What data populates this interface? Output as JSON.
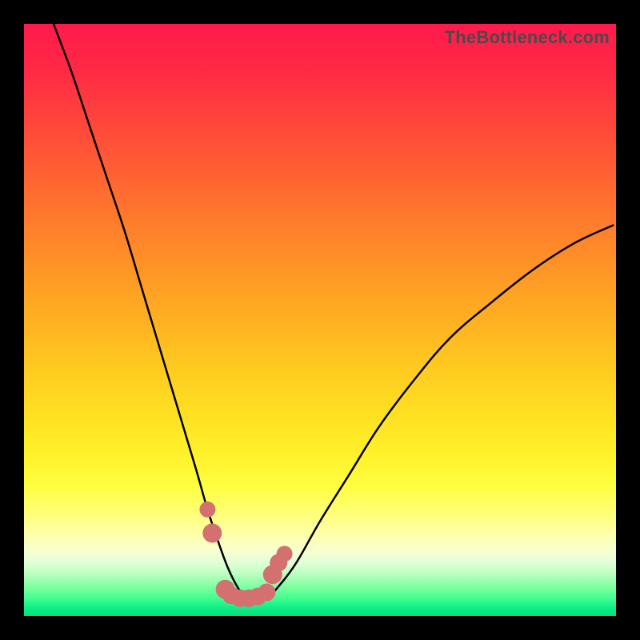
{
  "watermark": "TheBottleneck.com",
  "chart_data": {
    "type": "line",
    "title": "",
    "xlabel": "",
    "ylabel": "",
    "xlim": [
      0,
      100
    ],
    "ylim": [
      0,
      100
    ],
    "grid": false,
    "legend": false,
    "colors": {
      "curve": "#000000",
      "markers_fill": "#d47070",
      "markers_stroke": "#b85050",
      "background_top": "#ff1a4d",
      "background_bottom": "#00e080"
    },
    "curve": {
      "name": "bottleneck-curve",
      "x": [
        5,
        8,
        11,
        14,
        17,
        20,
        23,
        26,
        29,
        31,
        33,
        34.5,
        36,
        37.5,
        39,
        41,
        43,
        46,
        50,
        55,
        60,
        66,
        72,
        79,
        86,
        93,
        99.5
      ],
      "y": [
        100,
        92,
        83,
        74,
        65,
        55,
        45,
        35,
        25,
        18,
        12,
        8,
        5,
        3,
        2.5,
        3,
        5,
        9,
        16,
        24,
        32,
        40,
        47,
        53,
        58.5,
        63,
        66
      ]
    },
    "markers": {
      "name": "bottleneck-markers",
      "x": [
        31.0,
        31.8,
        34.0,
        35.0,
        36.5,
        38.0,
        39.5,
        41.0,
        42.0,
        43.0,
        44.0
      ],
      "y": [
        18.0,
        14.0,
        4.5,
        3.5,
        3.0,
        3.0,
        3.3,
        4.0,
        7.0,
        9.0,
        10.5
      ],
      "r": [
        10,
        12,
        12,
        11,
        11,
        11,
        11,
        11,
        12,
        11,
        10
      ]
    }
  }
}
